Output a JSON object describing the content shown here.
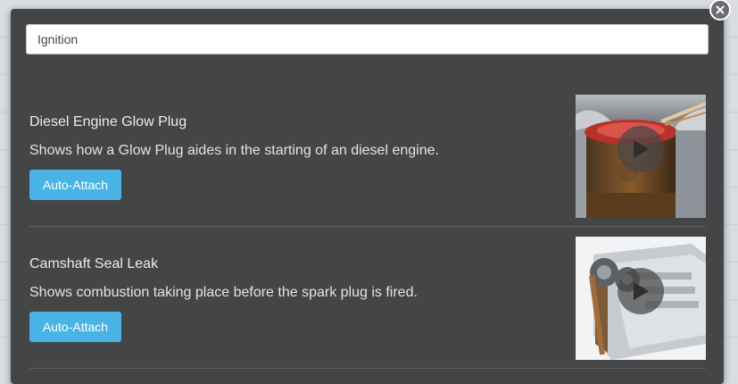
{
  "search": {
    "value": "Ignition",
    "placeholder": ""
  },
  "results": [
    {
      "title": "Diesel Engine Glow Plug",
      "description": "Shows how a Glow Plug aides in the starting of an diesel engine.",
      "button_label": "Auto-Attach",
      "thumbnail_icon": "play-icon"
    },
    {
      "title": "Camshaft Seal Leak",
      "description": "Shows combustion taking place before the spark plug is fired.",
      "button_label": "Auto-Attach",
      "thumbnail_icon": "play-icon"
    }
  ],
  "colors": {
    "modal_bg": "#444546",
    "accent": "#4ab3e6"
  }
}
